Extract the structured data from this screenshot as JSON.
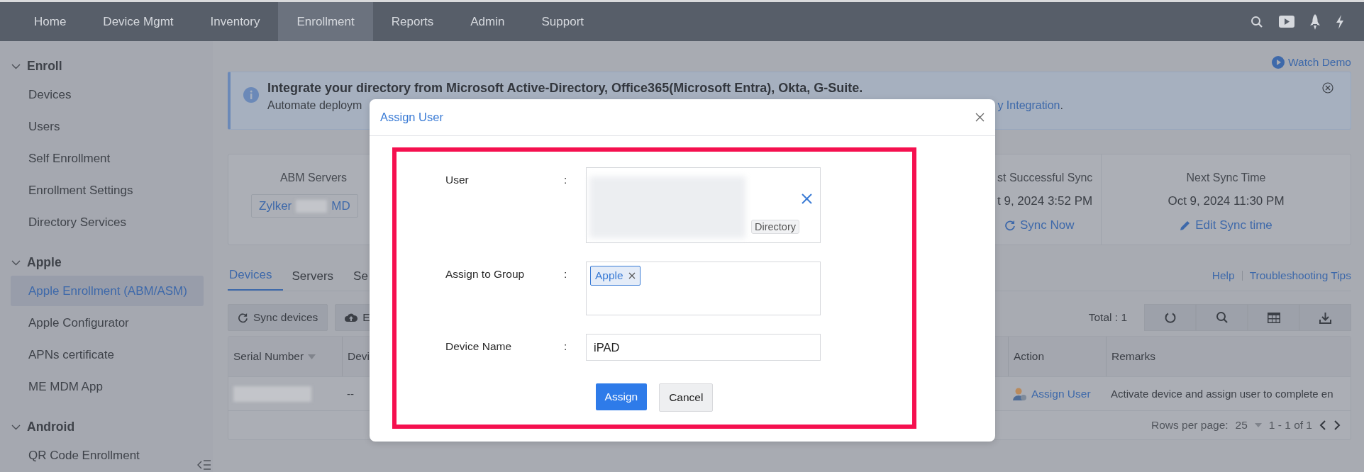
{
  "nav": {
    "items": [
      {
        "label": "Home",
        "selected": false
      },
      {
        "label": "Device Mgmt",
        "selected": false
      },
      {
        "label": "Inventory",
        "selected": false
      },
      {
        "label": "Enrollment",
        "selected": true
      },
      {
        "label": "Reports",
        "selected": false
      },
      {
        "label": "Admin",
        "selected": false
      },
      {
        "label": "Support",
        "selected": false
      }
    ]
  },
  "sidebar": {
    "sections": [
      {
        "title": "Enroll",
        "expanded": true,
        "items": [
          {
            "label": "Devices",
            "selected": false
          },
          {
            "label": "Users",
            "selected": false
          },
          {
            "label": "Self Enrollment",
            "selected": false
          },
          {
            "label": "Enrollment Settings",
            "selected": false
          },
          {
            "label": "Directory Services",
            "selected": false
          }
        ]
      },
      {
        "title": "Apple",
        "expanded": true,
        "items": [
          {
            "label": "Apple Enrollment (ABM/ASM)",
            "selected": true
          },
          {
            "label": "Apple Configurator",
            "selected": false
          },
          {
            "label": "APNs certificate",
            "selected": false
          },
          {
            "label": "ME MDM App",
            "selected": false
          }
        ]
      },
      {
        "title": "Android",
        "expanded": true,
        "items": [
          {
            "label": "QR Code Enrollment",
            "selected": false
          }
        ]
      }
    ]
  },
  "watch_demo": "Watch Demo",
  "banner": {
    "title": "Integrate your directory from Microsoft Active-Directory, Office365(Microsoft Entra), Okta, G-Suite.",
    "text_start": "Automate deploym",
    "link": "y Integration",
    "text_end": "."
  },
  "servers_card": {
    "abm_label": "ABM Servers",
    "server_prefix": "Zylker",
    "server_suffix": "MD",
    "last_sync_label": "st Successful Sync",
    "last_sync_value": "t 9, 2024 3:52 PM",
    "sync_now": "Sync Now",
    "next_sync_label": "Next Sync Time",
    "next_sync_value": "Oct 9, 2024 11:30 PM",
    "edit_sync": "Edit Sync time"
  },
  "tabs": [
    {
      "label": "Devices",
      "selected": true
    },
    {
      "label": "Servers",
      "selected": false
    },
    {
      "label": "Se",
      "selected": false
    }
  ],
  "help_links": [
    "Help",
    "Troubleshooting Tips"
  ],
  "toolbar": {
    "sync_devices": "Sync devices",
    "cut_button": "E",
    "total": "Total : 1"
  },
  "table": {
    "columns_left": [
      "Serial Number",
      "Devi"
    ],
    "columns_right": [
      "Action",
      "Remarks"
    ],
    "rows": [
      {
        "column_2": "--",
        "action": "Assign User",
        "remarks": "Activate device and assign user to complete en"
      }
    ],
    "rows_per_page_label": "Rows per page:",
    "rows_per_page": "25",
    "range": "1 - 1 of 1"
  },
  "modal": {
    "title": "Assign User",
    "fields": [
      {
        "kind": "user",
        "label": "User",
        "colon": ":",
        "chip": "Directory"
      },
      {
        "kind": "tags",
        "label": "Assign to Group",
        "colon": ":",
        "tags": [
          "Apple"
        ]
      },
      {
        "kind": "text",
        "label": "Device Name",
        "colon": ":",
        "value": "iPAD"
      }
    ],
    "buttons": [
      {
        "label": "Assign",
        "kind": "primary"
      },
      {
        "label": "Cancel",
        "kind": "secondary"
      }
    ]
  }
}
